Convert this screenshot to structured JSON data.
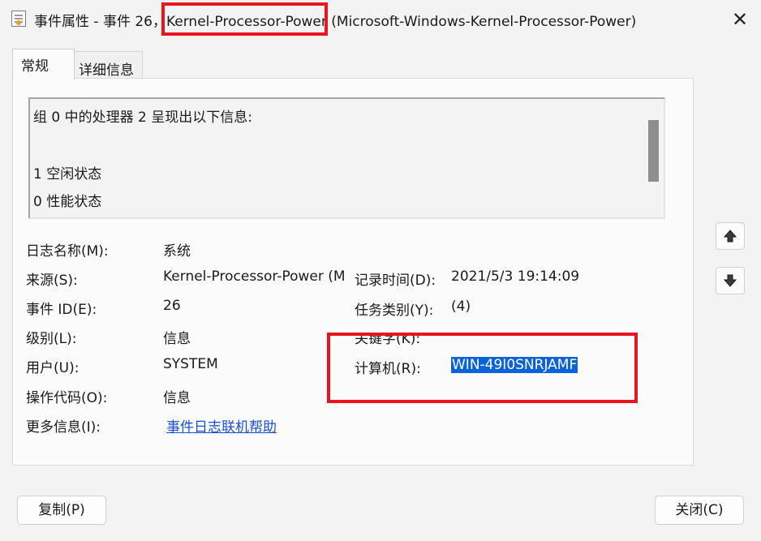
{
  "window": {
    "title_prefix": "事件属性 - 事件 26，",
    "title_source": "Kernel-Processor-Power",
    "title_suffix": "(Microsoft-Windows-Kernel-Processor-Power)",
    "close_glyph": "✕"
  },
  "tabs": [
    {
      "label": "常规",
      "active": true
    },
    {
      "label": "详细信息",
      "active": false
    }
  ],
  "description": {
    "lines": [
      "组 0 中的处理器 2 呈现出以下信息:",
      "",
      "1 空闲状态",
      "0 性能状态"
    ]
  },
  "fields": {
    "log_name_label": "日志名称(M):",
    "log_name_value": "系统",
    "source_label": "来源(S):",
    "source_value": "Kernel-Processor-Power (M",
    "event_id_label": "事件 ID(E):",
    "event_id_value": "26",
    "level_label": "级别(L):",
    "level_value": "信息",
    "user_label": "用户(U):",
    "user_value": "SYSTEM",
    "opcode_label": "操作代码(O):",
    "opcode_value": "信息",
    "more_info_label": "更多信息(I):",
    "more_info_link": "事件日志联机帮助",
    "logged_label": "记录时间(D):",
    "logged_value": "2021/5/3 19:14:09",
    "task_category_label": "任务类别(Y):",
    "task_category_value": "(4)",
    "keywords_label": "关键字(K):",
    "computer_label": "计算机(R):",
    "computer_value": "WIN-49I0SNRJAMF"
  },
  "nav": {
    "up_icon": "arrow-up-icon",
    "down_icon": "arrow-down-icon"
  },
  "buttons": {
    "copy": "复制(P)",
    "close": "关闭(C)"
  },
  "colors": {
    "highlight_box": "#e8141e",
    "selection": "#0a63d8",
    "link": "#1a4fd8"
  }
}
